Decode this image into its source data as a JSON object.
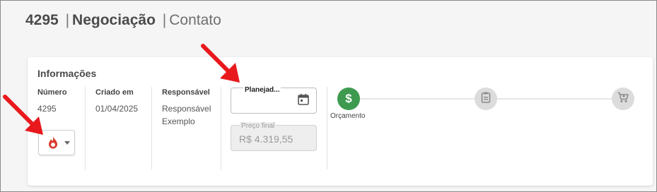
{
  "header": {
    "number": "4295",
    "section": "Negociação",
    "separator": "|",
    "context": "Contato"
  },
  "info": {
    "title": "Informações",
    "numero_label": "Número",
    "numero_value": "4295",
    "criado_label": "Criado em",
    "criado_value": "01/04/2025",
    "responsavel_label": "Responsável",
    "responsavel_line1": "Responsável",
    "responsavel_line2": "Exemplo",
    "temperature_icon": "flame-icon"
  },
  "fields": {
    "planejado_label": "Planejad...",
    "planejado_value": "",
    "preco_label": "Preço final",
    "preco_value": "R$ 4.319,55"
  },
  "steps": [
    {
      "label": "Orçamento",
      "icon": "dollar-icon",
      "state": "active"
    },
    {
      "label": "",
      "icon": "clipboard-icon",
      "state": "inactive"
    },
    {
      "label": "",
      "icon": "cart-icon",
      "state": "inactive"
    }
  ],
  "colors": {
    "accent_green": "#3d9a4f",
    "flame_red": "#d93a2b",
    "annotation_arrow": "#e8191d"
  }
}
